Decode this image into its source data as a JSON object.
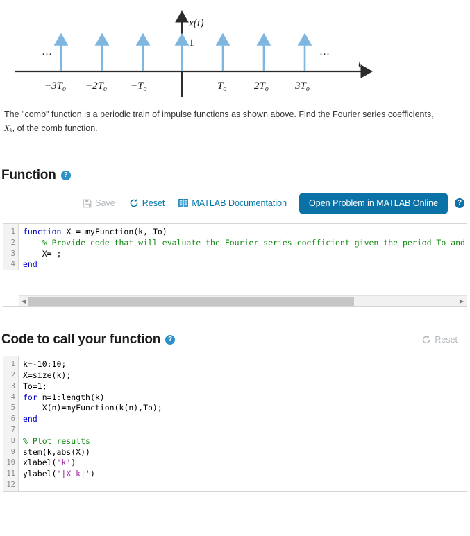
{
  "figure": {
    "y_axis_label": "x(t)",
    "x_axis_label": "t",
    "amplitude_label": "1",
    "left_ellipsis": "⋯",
    "right_ellipsis": "⋯",
    "impulse_labels": [
      "−3T",
      "−2T",
      "−T",
      "T",
      "2T",
      "3T"
    ],
    "impulse_subscript": "o",
    "impulse_color": "#7eb6e0",
    "axis_color": "#2b2b2b"
  },
  "problem": {
    "line1": "The \"comb\" function is a periodic train of impulse functions as shown above.  Find the Fourier series coefficients,",
    "line2_var": "X",
    "line2_sub": "k",
    "line2_rest": ", of the comb function."
  },
  "function_section": {
    "title": "Function",
    "help_label": "?",
    "toolbar": {
      "save_label": "Save",
      "save_disabled": true,
      "reset_label": "Reset",
      "docs_label": "MATLAB Documentation",
      "open_online_label": "Open Problem in MATLAB Online",
      "help_label": "?"
    },
    "editor": {
      "line_numbers": [
        "1",
        "2",
        "3",
        "4"
      ],
      "lines": [
        [
          {
            "t": "function",
            "c": "kw"
          },
          {
            "t": " X = myFunction(k, To)",
            "c": ""
          }
        ],
        [
          {
            "t": "    % Provide code that will evaluate the Fourier series coefficient given the period To and",
            "c": "cm"
          }
        ],
        [
          {
            "t": "    X= ;",
            "c": ""
          }
        ],
        [
          {
            "t": "end",
            "c": "kw"
          }
        ]
      ],
      "scroll_thumb_percent": 76
    }
  },
  "call_section": {
    "title": "Code to call your function",
    "help_label": "?",
    "reset_label": "Reset",
    "reset_disabled": true,
    "editor": {
      "line_numbers": [
        "1",
        "2",
        "3",
        "4",
        "5",
        "6",
        "7",
        "8",
        "9",
        "10",
        "11",
        "12"
      ],
      "lines": [
        [
          {
            "t": "k=-10:10;",
            "c": ""
          }
        ],
        [
          {
            "t": "X=size(k);",
            "c": ""
          }
        ],
        [
          {
            "t": "To=1;",
            "c": ""
          }
        ],
        [
          {
            "t": "for",
            "c": "kw"
          },
          {
            "t": " n=1:length(k)",
            "c": ""
          }
        ],
        [
          {
            "t": "    X(n)=myFunction(k(n),To);",
            "c": ""
          }
        ],
        [
          {
            "t": "end",
            "c": "kw"
          }
        ],
        [
          {
            "t": "",
            "c": ""
          }
        ],
        [
          {
            "t": "% Plot results",
            "c": "cm"
          }
        ],
        [
          {
            "t": "stem(k,abs(X))",
            "c": ""
          }
        ],
        [
          {
            "t": "xlabel(",
            "c": ""
          },
          {
            "t": "'k'",
            "c": "str"
          },
          {
            "t": ")",
            "c": ""
          }
        ],
        [
          {
            "t": "ylabel(",
            "c": ""
          },
          {
            "t": "'|X_k|'",
            "c": "str"
          },
          {
            "t": ")",
            "c": ""
          }
        ],
        [
          {
            "t": "",
            "c": ""
          }
        ]
      ]
    }
  },
  "colors": {
    "accent_blue": "#0076a8",
    "primary_button": "#0b72a8",
    "help_icon": "#2c91c4",
    "disabled_gray": "#b4b9bc",
    "keyword": "#0000d0",
    "comment": "#118a11",
    "string": "#a020a0"
  }
}
